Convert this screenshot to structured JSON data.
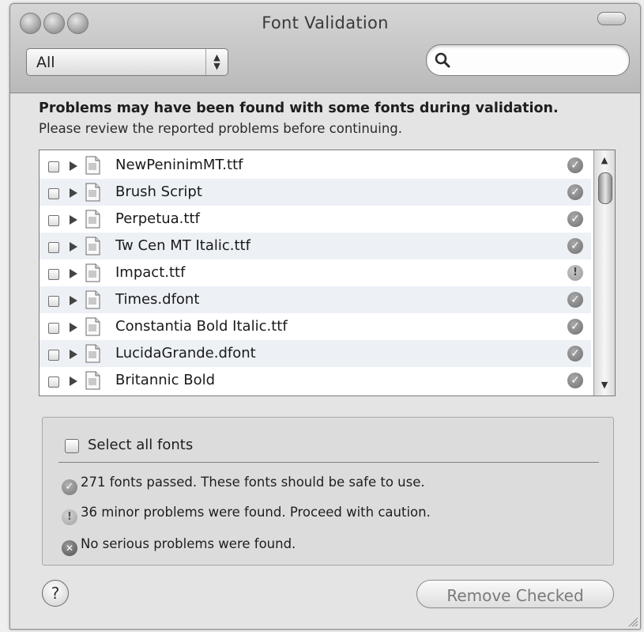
{
  "window": {
    "title": "Font Validation"
  },
  "toolbar": {
    "filter_value": "All",
    "search_placeholder": ""
  },
  "message": {
    "bold": "Problems may have been found with some fonts during validation.",
    "detail": "Please review the reported problems before continuing."
  },
  "fonts": [
    {
      "name": "NewPeninimMT.ttf",
      "status": "passed"
    },
    {
      "name": "Brush Script",
      "status": "passed"
    },
    {
      "name": "Perpetua.ttf",
      "status": "passed"
    },
    {
      "name": "Tw Cen MT Italic.ttf",
      "status": "passed"
    },
    {
      "name": "Impact.ttf",
      "status": "warning"
    },
    {
      "name": "Times.dfont",
      "status": "passed"
    },
    {
      "name": "Constantia Bold Italic.ttf",
      "status": "passed"
    },
    {
      "name": "LucidaGrande.dfont",
      "status": "passed"
    },
    {
      "name": "Britannic Bold",
      "status": "passed"
    }
  ],
  "summary": {
    "select_all_label": "Select all fonts",
    "passed_text": "271 fonts passed. These fonts should be safe to use.",
    "minor_text": "36 minor problems were found. Proceed with caution.",
    "serious_text": "No serious problems were found."
  },
  "buttons": {
    "help_label": "?",
    "remove_label": "Remove Checked"
  },
  "icons": {
    "passed": "check-circle-icon",
    "warning": "exclamation-circle-icon",
    "error": "x-circle-icon"
  }
}
